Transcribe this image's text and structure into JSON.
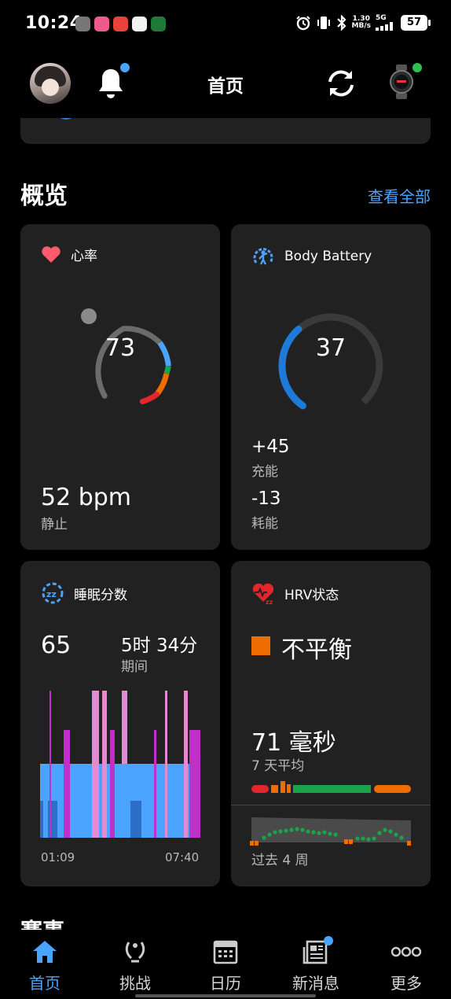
{
  "status_bar": {
    "time": "10:24",
    "net_speed_top": "1.30",
    "net_speed_bottom": "MB/s",
    "network": "5G",
    "battery": "57"
  },
  "header": {
    "title": "首页"
  },
  "overview": {
    "section_title": "概览",
    "view_all": "查看全部"
  },
  "heart_rate": {
    "title": "心率",
    "current": "73",
    "resting_value": "52 bpm",
    "resting_label": "静止"
  },
  "body_battery": {
    "title": "Body Battery",
    "current": "37",
    "level_fraction": 0.37,
    "charged_value": "+45",
    "charged_label": "充能",
    "drained_value": "-13",
    "drained_label": "耗能"
  },
  "sleep": {
    "title": "睡眠分数",
    "score": "65",
    "duration": "5时 34分",
    "duration_label": "期间",
    "start_time": "01:09",
    "end_time": "07:40"
  },
  "hrv": {
    "title": "HRV状态",
    "status": "不平衡",
    "value": "71 毫秒",
    "value_label": "7 天平均",
    "period_label": "过去 4 周"
  },
  "next_section_partial": "赛事",
  "tabs": [
    {
      "label": "首页"
    },
    {
      "label": "挑战"
    },
    {
      "label": "日历"
    },
    {
      "label": "新消息"
    },
    {
      "label": "更多"
    }
  ],
  "colors": {
    "accent": "#4aa3ff",
    "card_bg": "#212121",
    "hrv_unbalanced": "#ef6c00",
    "hrv_balanced": "#1aa34a",
    "heart": "#ff5a6e"
  }
}
